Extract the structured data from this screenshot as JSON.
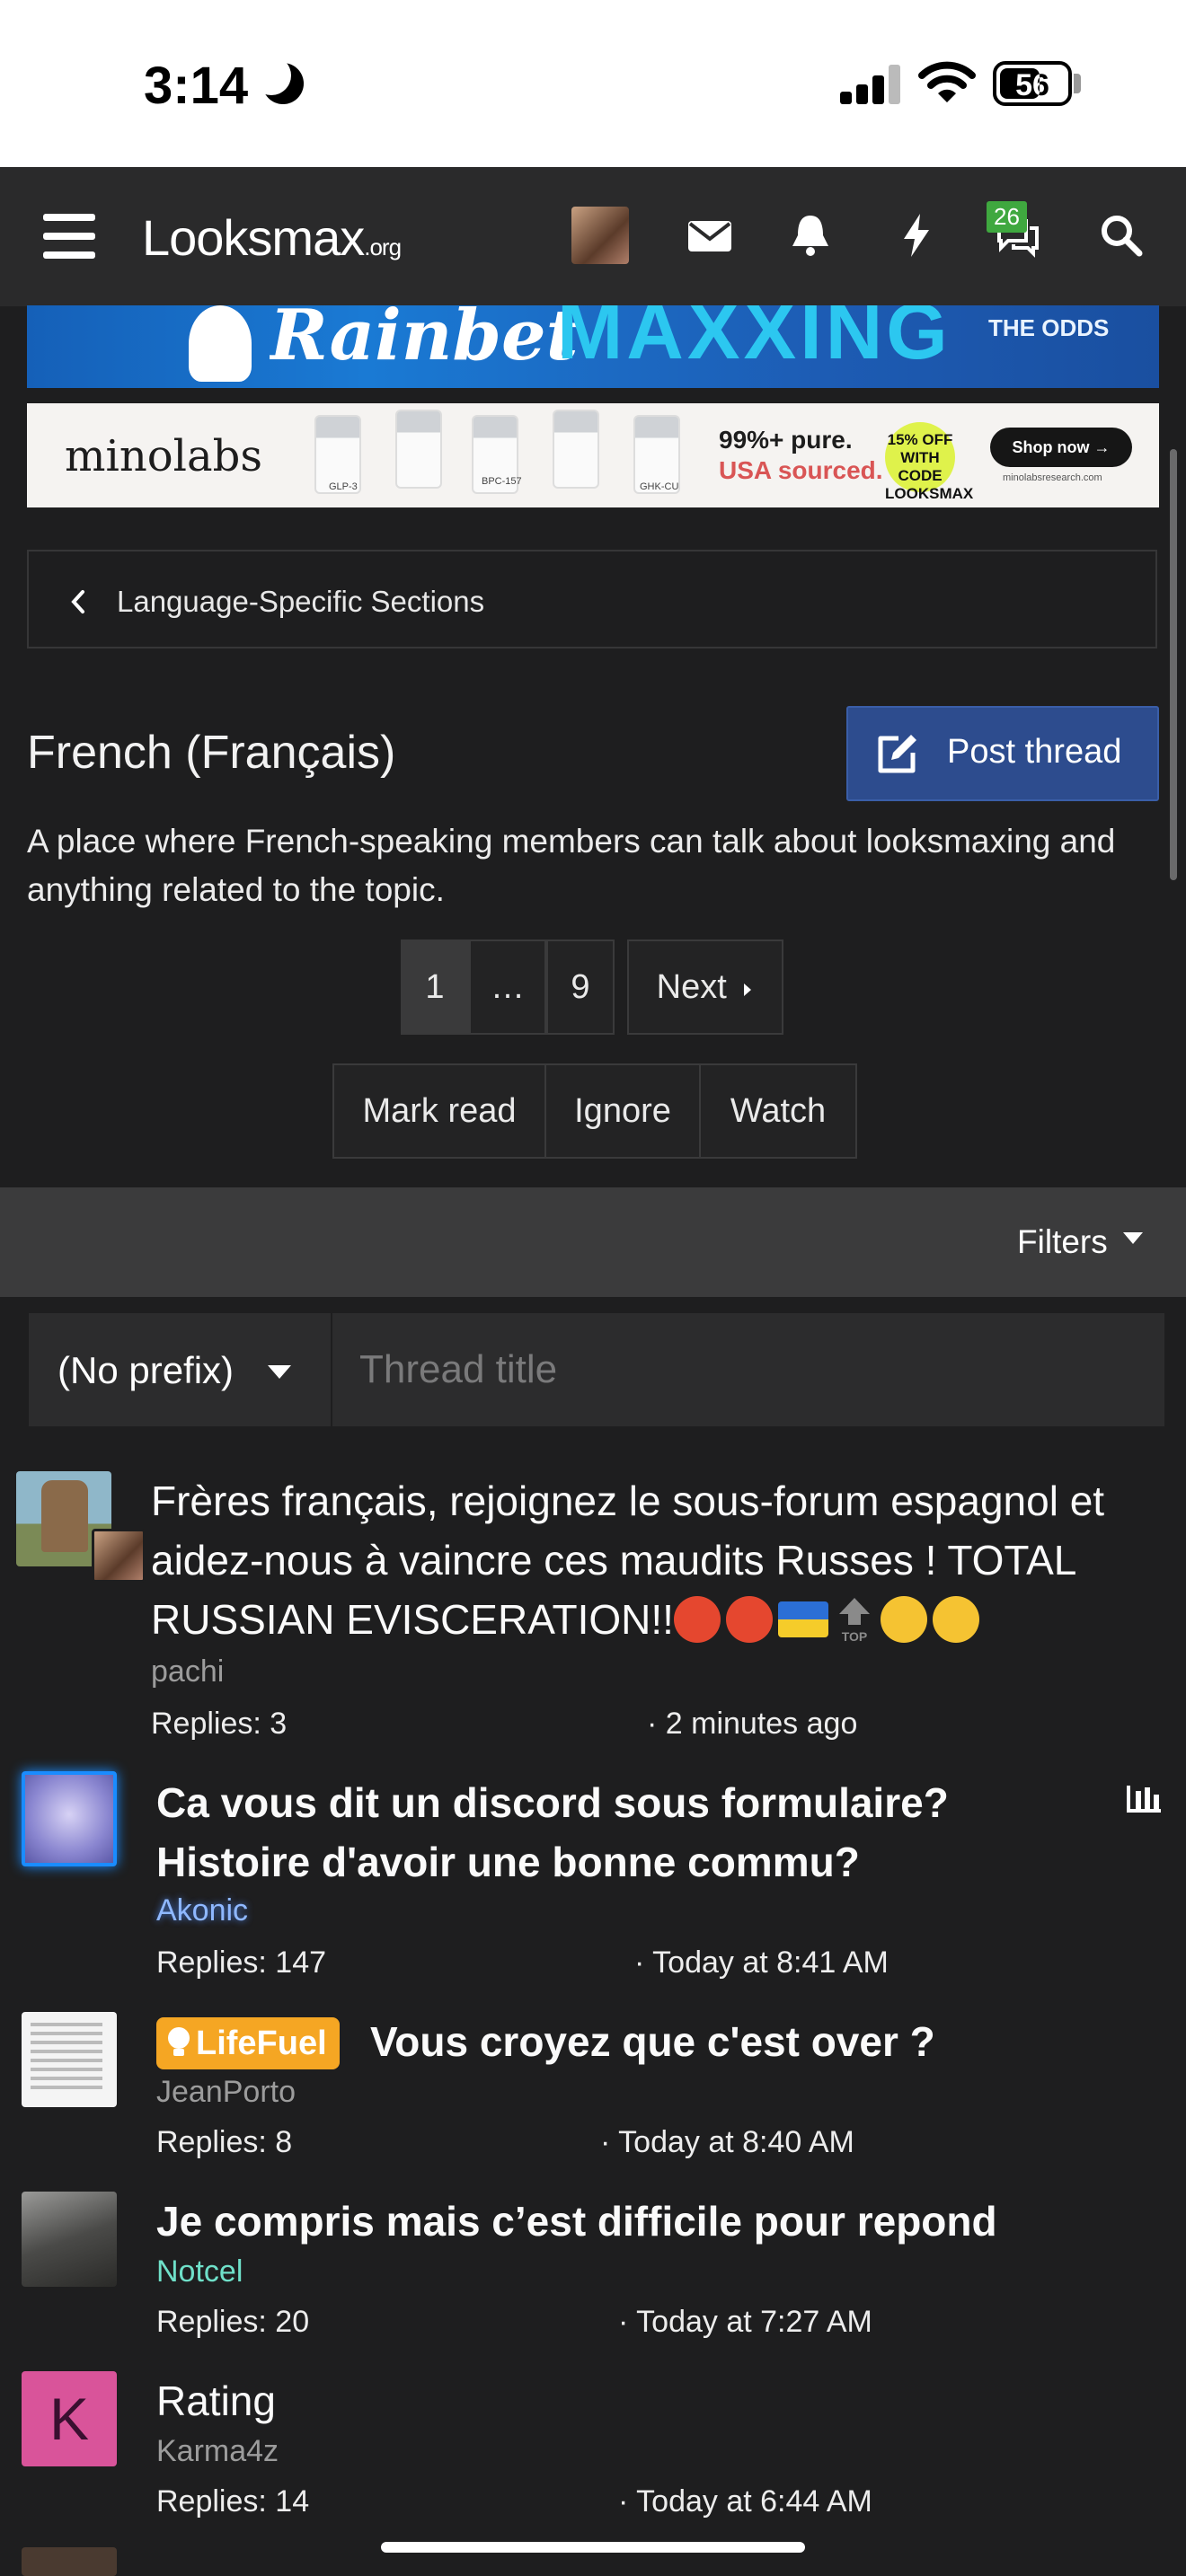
{
  "status_bar": {
    "time": "3:14",
    "battery": "56"
  },
  "nav": {
    "logo_main": "Looksmax",
    "logo_suffix": ".org",
    "conversations_badge": "26"
  },
  "banners": {
    "rainbet": {
      "brand": "Rainbet",
      "word": "MAXXING",
      "tagline": "THE ODDS"
    },
    "minolabs": {
      "brand": "minolabs",
      "vial_labels": [
        "GLP-3",
        "BPC-157",
        "GHK-CU"
      ],
      "claim_line1": "99%+ pure.",
      "claim_line2": "USA sourced.",
      "offer": "15% OFF WITH CODE LOOKSMAX",
      "shop_button": "Shop now →",
      "url": "minolabsresearch.com"
    }
  },
  "breadcrumb": {
    "label": "Language-Specific Sections"
  },
  "header": {
    "title": "French (Français)",
    "post_thread_label": "Post thread",
    "description": "A place where French-speaking members can talk about looksmaxing and anything related to the topic."
  },
  "pagination": {
    "current": "1",
    "ellipsis": "…",
    "last": "9",
    "next": "Next"
  },
  "actions": {
    "mark_read": "Mark read",
    "ignore": "Ignore",
    "watch": "Watch"
  },
  "filters": {
    "label": "Filters",
    "prefix": "(No prefix)",
    "title_placeholder": "Thread title"
  },
  "threads": [
    {
      "title": "Frères français, rejoignez le sous-forum espagnol et aidez-nous à vaincre ces maudits Russes ! TOTAL RUSSIAN EVISCERATION!!",
      "author": "pachi",
      "replies": "Replies: 3",
      "date": "· 2 minutes ago",
      "bold": false
    },
    {
      "title": "Ca vous dit un discord sous formulaire? Histoire d'avoir une bonne commu?",
      "author": "Akonic",
      "replies": "Replies: 147",
      "date": "· Today at 8:41 AM",
      "bold": true
    },
    {
      "prefix": "LifeFuel",
      "title": "Vous croyez que c'est over ?",
      "author": "JeanPorto",
      "replies": "Replies: 8",
      "date": "· Today at 8:40 AM",
      "bold": true
    },
    {
      "title": "Je compris mais c’est difficile pour repond",
      "author": "Notcel",
      "replies": "Replies: 20",
      "date": "· Today at 7:27 AM",
      "bold": true
    },
    {
      "title": "Rating",
      "author": "Karma4z",
      "avatar_letter": "K",
      "replies": "Replies: 14",
      "date": "· Today at 6:44 AM",
      "bold": false
    }
  ],
  "colors": {
    "background": "#1e1e1f",
    "post_thread_button": "#2d4c8e",
    "lifefuel_prefix": "#f5a623",
    "author_akonic": "#8fb8ff",
    "author_notcel": "#6fe0c9",
    "avatar_k": "#d9549a"
  }
}
